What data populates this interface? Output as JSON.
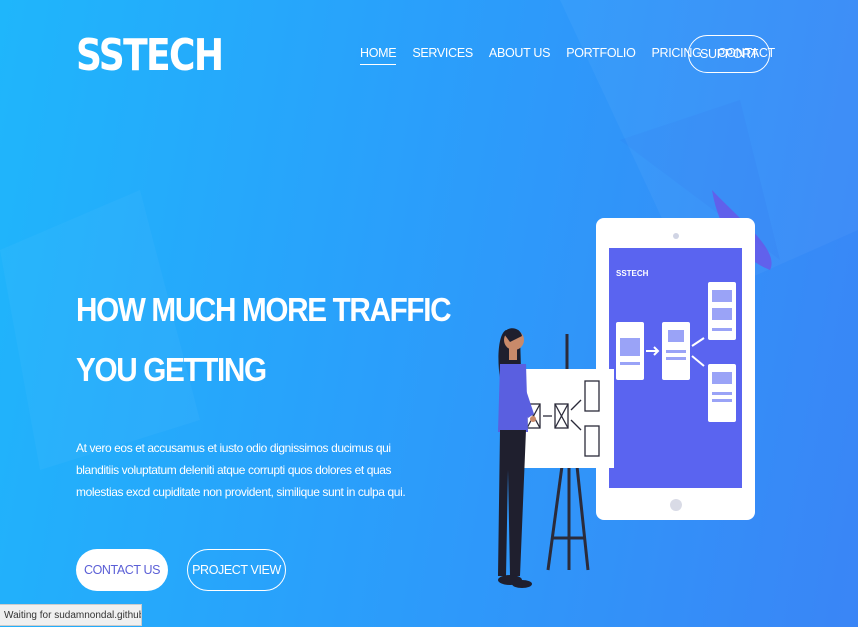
{
  "brand": {
    "logo": "SSTECH"
  },
  "nav": {
    "items": [
      {
        "label": "HOME",
        "active": true
      },
      {
        "label": "SERVICES"
      },
      {
        "label": "ABOUT US"
      },
      {
        "label": "PORTFOLIO"
      },
      {
        "label": "PRICING"
      },
      {
        "label": "CONTACT"
      }
    ],
    "support_label": "SUPPORT"
  },
  "hero": {
    "title_line1": "HOW MUCH MORE TRAFFIC",
    "title_line2": "YOU GETTING",
    "paragraph": "At vero eos et accusamus et iusto odio dignissimos ducimus qui blanditiis voluptatum deleniti atque corrupti quos dolores et quas molestias excd cupiditate non provident, similique sunt in culpa qui.",
    "contact_button": "CONTACT US",
    "project_button": "PROJECT VIEW"
  },
  "illustration": {
    "tablet_logo": "SSTECH"
  },
  "status": {
    "text": "Waiting for sudamnondal.github.io..."
  },
  "colors": {
    "bg_start": "#1fb6fb",
    "bg_end": "#3a85f6",
    "accent": "#5b5fd6",
    "tablet_screen": "#5a64f0"
  }
}
